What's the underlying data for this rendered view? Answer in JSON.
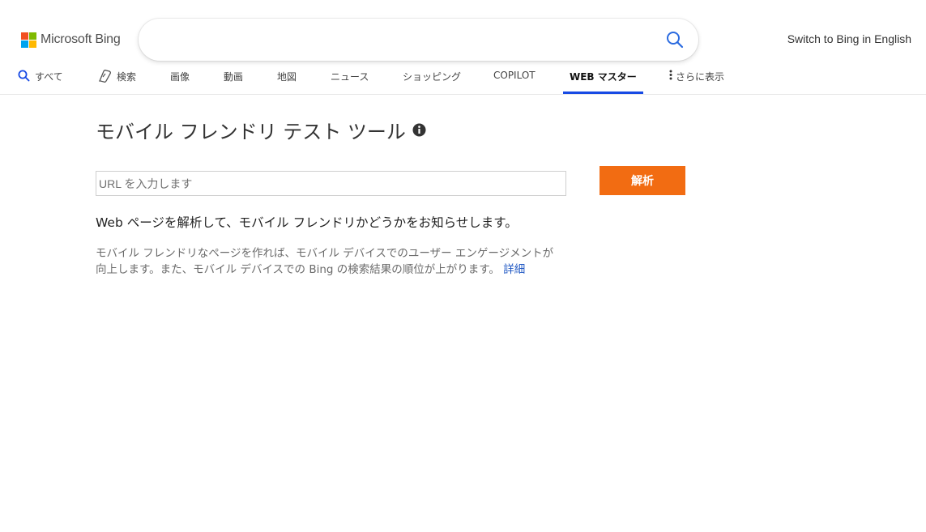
{
  "header": {
    "logo_text": "Microsoft Bing",
    "logo_colors": [
      "#f25022",
      "#7fba00",
      "#00a4ef",
      "#ffb900"
    ],
    "search_value": "",
    "search_icon": "search-icon",
    "switch_language": "Switch to Bing in English"
  },
  "nav": {
    "items": [
      {
        "label": "すべて",
        "icon": "search-icon"
      },
      {
        "label": "検索",
        "icon": "copilot-icon"
      },
      {
        "label": "画像"
      },
      {
        "label": "動画"
      },
      {
        "label": "地図"
      },
      {
        "label": "ニュース"
      },
      {
        "label": "ショッピング"
      },
      {
        "label": "COPILOT"
      },
      {
        "label": "WEB マスター",
        "active": true
      },
      {
        "label": "さらに表示",
        "icon": "more-vertical-icon"
      }
    ],
    "accent_color": "#174ae4"
  },
  "main": {
    "title": "モバイル フレンドリ テスト ツール",
    "title_icon": "info-icon",
    "url_placeholder": "URL を入力します",
    "url_value": "",
    "analyze_button": "解析",
    "analyze_color": "#f26c12",
    "lead_text": "Web ページを解析して、モバイル フレンドリかどうかをお知らせします。",
    "description": "モバイル フレンドリなページを作れば、モバイル デバイスでのユーザー エンゲージメントが向上します。また、モバイル デバイスでの Bing の検索結果の順位が上がります。",
    "details_link": "詳細"
  }
}
